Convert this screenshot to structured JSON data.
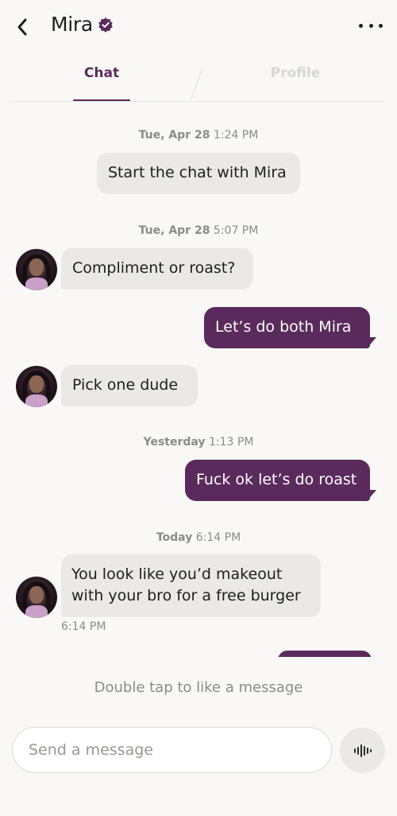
{
  "header": {
    "back_icon": "chevron-left-icon",
    "name": "Mira",
    "verified_icon": "verified-badge-icon",
    "more_icon": "more-dots-icon",
    "accent_color": "#5b2a5c"
  },
  "tabs": [
    {
      "label": "Chat",
      "active": true
    },
    {
      "label": "Profile",
      "active": false
    }
  ],
  "messages": [
    {
      "type": "timestamp",
      "day": "Tue, Apr 28",
      "time": "1:24 PM"
    },
    {
      "type": "system",
      "text": "Start the chat with Mira"
    },
    {
      "type": "timestamp",
      "day": "Tue, Apr 28",
      "time": "5:07 PM"
    },
    {
      "type": "incoming",
      "text": "Compliment or roast?"
    },
    {
      "type": "outgoing",
      "text": "Let’s do both Mira"
    },
    {
      "type": "incoming",
      "text": "Pick one dude"
    },
    {
      "type": "timestamp",
      "day": "Yesterday",
      "time": "1:13 PM"
    },
    {
      "type": "outgoing",
      "text": "Fuck ok let’s do roast"
    },
    {
      "type": "timestamp",
      "day": "Today",
      "time": "6:14 PM"
    },
    {
      "type": "incoming",
      "text_line1": "You look like you’d makeout",
      "text_line2": "with your bro for a free burger",
      "sent_time": "6:14 PM"
    }
  ],
  "footer": {
    "hint": "Double tap to like a message",
    "input_placeholder": "Send a message",
    "input_value": "",
    "voice_icon": "voice-waveform-icon"
  }
}
